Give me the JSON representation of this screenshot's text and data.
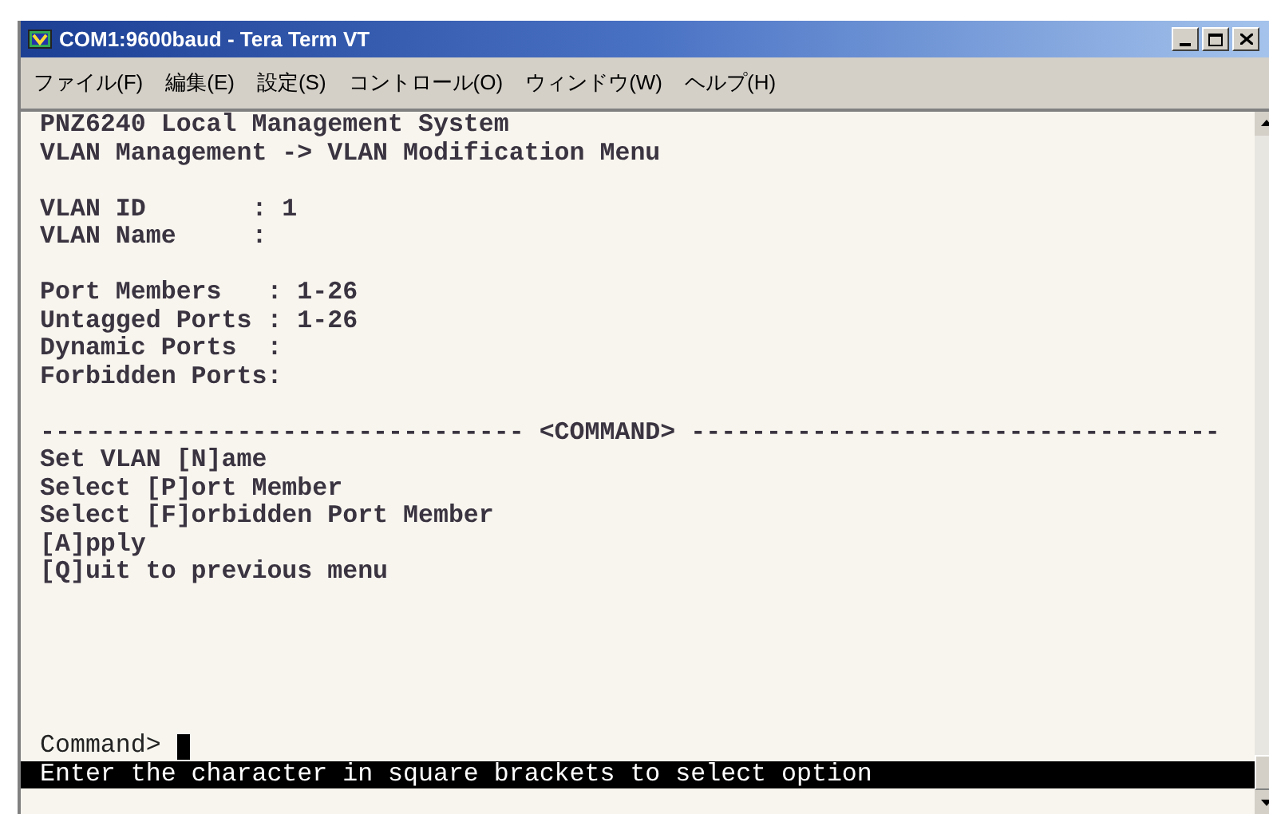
{
  "window": {
    "title": "COM1:9600baud - Tera Term VT"
  },
  "menu": [
    "ファイル(F)",
    "編集(E)",
    "設定(S)",
    "コントロール(O)",
    "ウィンドウ(W)",
    "ヘルプ(H)"
  ],
  "terminal": {
    "blocks": [
      [
        "PNZ6240 Local Management System",
        "VLAN Management -> VLAN Modification Menu"
      ],
      [
        "VLAN ID       : 1",
        "VLAN Name     :"
      ],
      [
        "Port Members   : 1-26",
        "Untagged Ports : 1-26",
        "Dynamic Ports  :",
        "Forbidden Ports:"
      ],
      [
        "-------------------------------- <COMMAND> -----------------------------------",
        "Set VLAN [N]ame",
        "Select [P]ort Member",
        "Select [F]orbidden Port Member",
        "[A]pply",
        "[Q]uit to previous menu"
      ]
    ],
    "prompt": "Command>",
    "status": "Enter the character in square brackets to select option"
  }
}
